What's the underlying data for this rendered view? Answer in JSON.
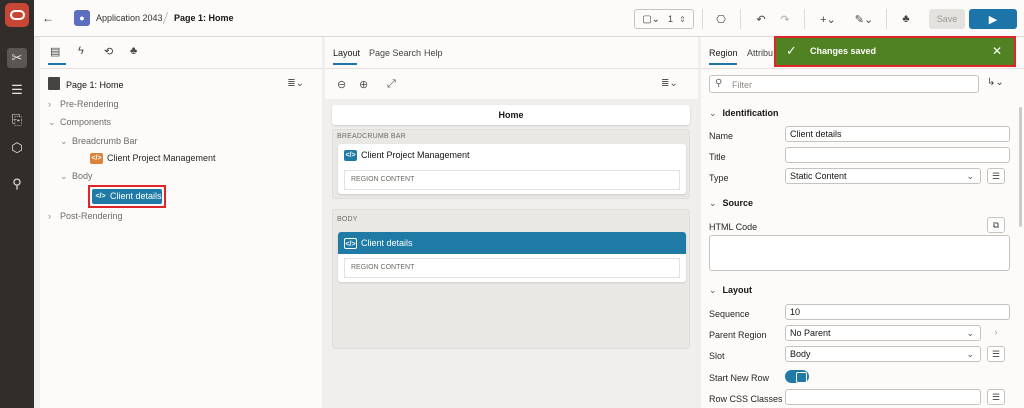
{
  "nav": {
    "items": [
      {
        "icon": "shared-components-icon",
        "glyph": "✂"
      },
      {
        "icon": "database-icon",
        "glyph": "☰"
      },
      {
        "icon": "page-add-icon",
        "glyph": "⎘"
      },
      {
        "icon": "package-icon",
        "glyph": "⬡"
      },
      {
        "icon": "search-icon",
        "glyph": "⚲"
      }
    ]
  },
  "toolbar": {
    "back_glyph": "←",
    "app_name": "Application 2043",
    "page_name": "Page 1: Home",
    "page_number": "1",
    "save_label": "Save",
    "run_glyph": "▶"
  },
  "tree": {
    "page_label": "Page 1: Home",
    "nodes": {
      "pre_rendering": "Pre-Rendering",
      "components": "Components",
      "breadcrumb_bar": "Breadcrumb Bar",
      "client_project_management": "Client Project Management",
      "body": "Body",
      "client_details": "Client details",
      "post_rendering": "Post-Rendering"
    }
  },
  "center": {
    "tabs": [
      "Layout",
      "Page Search",
      "Help"
    ],
    "home_label": "Home",
    "breadcrumb_slot_label": "BREADCRUMB BAR",
    "body_slot_label": "BODY",
    "region1_title": "Client Project Management",
    "region2_title": "Client details",
    "region_content_label": "REGION CONTENT"
  },
  "props": {
    "tabs": [
      "Region",
      "Attribu"
    ],
    "filter_placeholder": "Filter",
    "identification": {
      "title": "Identification",
      "name_label": "Name",
      "name_value": "Client details",
      "title_label": "Title",
      "title_value": "",
      "type_label": "Type",
      "type_value": "Static Content"
    },
    "source": {
      "title": "Source",
      "html_code_label": "HTML Code"
    },
    "layout": {
      "title": "Layout",
      "sequence_label": "Sequence",
      "sequence_value": "10",
      "parent_label": "Parent Region",
      "parent_value": "No Parent",
      "slot_label": "Slot",
      "slot_value": "Body",
      "start_new_row_label": "Start New Row",
      "start_new_row": true,
      "row_css_label": "Row CSS Classes",
      "row_css_value": ""
    }
  },
  "toast": {
    "message": "Changes saved",
    "color": "#508223"
  },
  "colors": {
    "accent": "#1f7ba6",
    "nav_bg": "#312d2a",
    "logo": "#c74634",
    "highlight": "#e0242a"
  }
}
